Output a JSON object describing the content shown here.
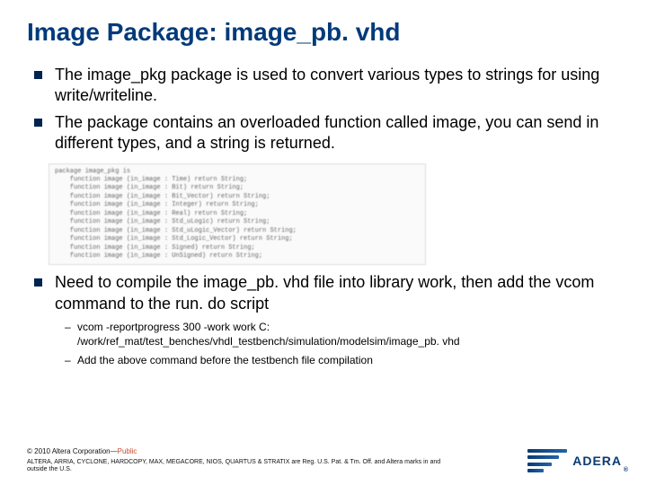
{
  "title": "Image Package: image_pb. vhd",
  "bullets": [
    "The image_pkg package is used to convert various types to strings for using write/writeline.",
    "The package contains an overloaded function called image, you can send in different types, and a string is returned."
  ],
  "code_block": "package image_pkg is\n    function image (in_image : Time) return String;\n    function image (in_image : Bit) return String;\n    function image (in_image : Bit_Vector) return String;\n    function image (in_image : Integer) return String;\n    function image (in_image : Real) return String;\n    function image (in_image : Std_uLogic) return String;\n    function image (in_image : Std_uLogic_Vector) return String;\n    function image (in_image : Std_Logic_Vector) return String;\n    function image (in_image : Signed) return String;\n    function image (in_image : UnSigned) return String;",
  "bullet3": "Need to compile the image_pb. vhd file into library work, then add the vcom command to the run. do script",
  "subs": [
    "vcom -reportprogress 300 -work work C: /work/ref_mat/test_benches/vhdl_testbench/simulation/modelsim/image_pb. vhd",
    "Add the above command before the testbench file compilation"
  ],
  "footer": {
    "copyright_prefix": "© 2010 Altera Corporation—",
    "copyright_public": "Public",
    "legal": "ALTERA, ARRIA, CYCLONE, HARDCOPY, MAX, MEGACORE, NIOS, QUARTUS & STRATIX are Reg. U.S. Pat. & Tm. Off. and Altera marks in and outside the U.S."
  },
  "logo": {
    "text": "ADERA",
    "reg": "®"
  }
}
